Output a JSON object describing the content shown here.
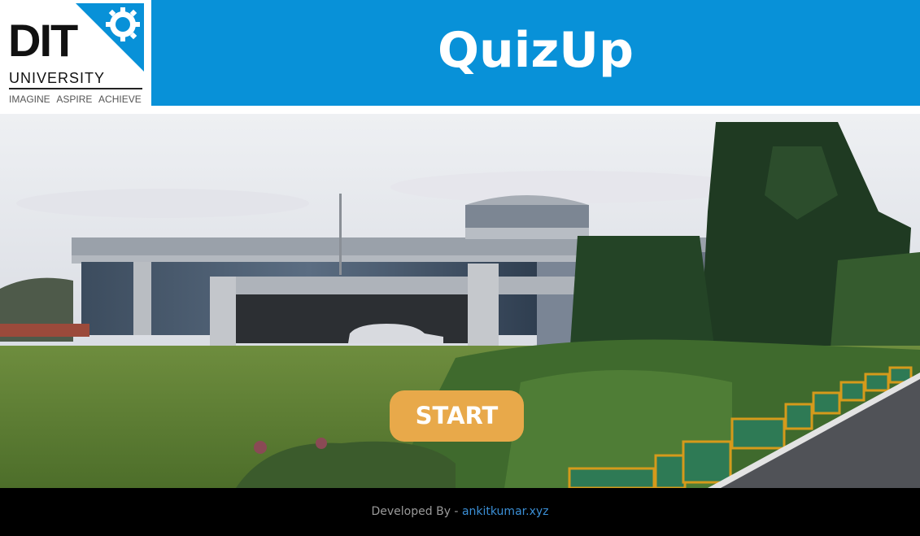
{
  "header": {
    "logo": {
      "wordmark": "DIT",
      "subtitle": "UNIVERSITY",
      "tagline": "IMAGINE  ASPIRE  ACHIEVE"
    },
    "title": "QuizUp"
  },
  "hero": {
    "image": "campus-building-photo"
  },
  "main": {
    "start_label": "START"
  },
  "footer": {
    "prefix": "Developed By - ",
    "link_text": "ankitkumar.xyz"
  },
  "colors": {
    "title_bar": "#0891d8",
    "start_button": "#e8a94a",
    "footer_bg": "#000000",
    "footer_link": "#3b8fd6"
  }
}
